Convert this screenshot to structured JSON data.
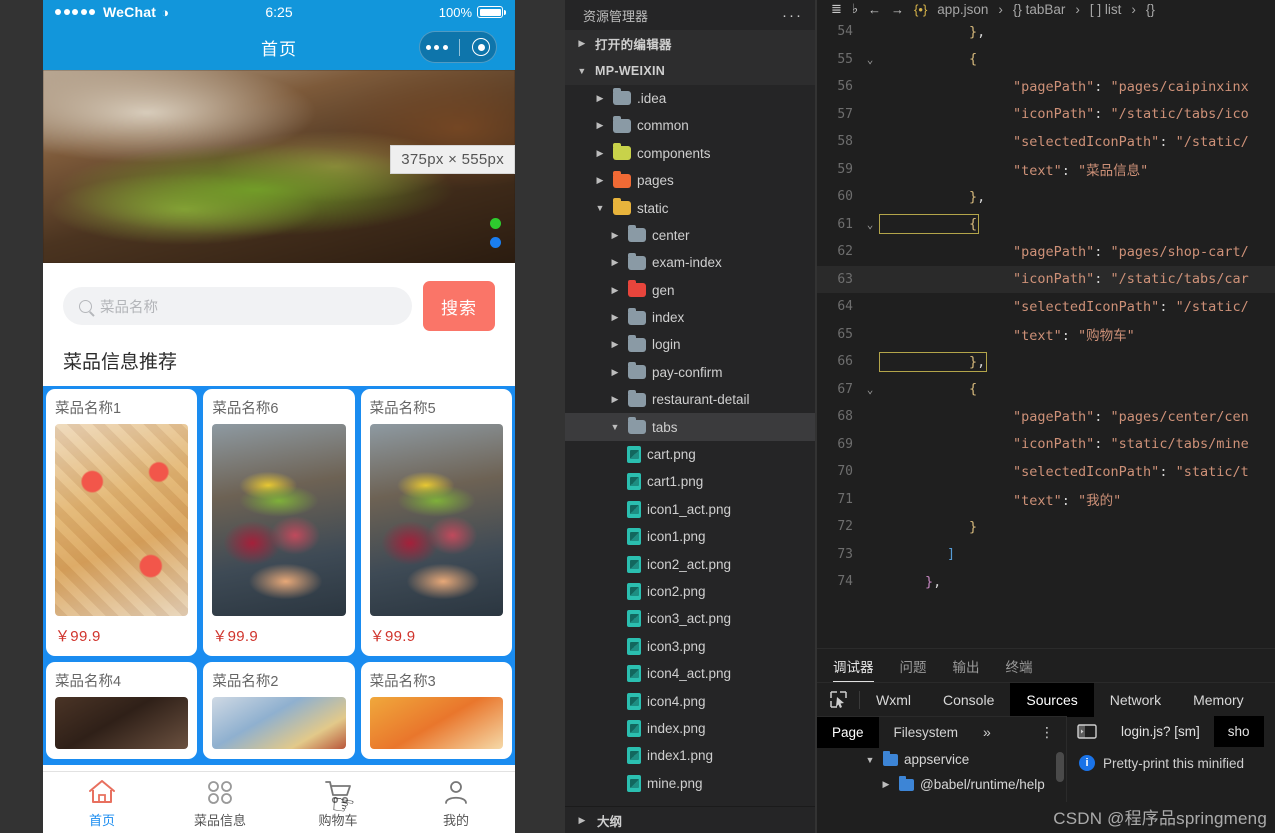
{
  "phone": {
    "status_bar": {
      "carrier": "WeChat",
      "time": "6:25",
      "battery": "100%"
    },
    "nav": {
      "title": "首页"
    },
    "hero": {
      "size_tooltip": "375px × 555px"
    },
    "search": {
      "placeholder": "菜品名称",
      "button_label": "搜索"
    },
    "section_title": "菜品信息推荐",
    "cards_row1": [
      {
        "name": "菜品名称1",
        "price": "￥99.9"
      },
      {
        "name": "菜品名称6",
        "price": "￥99.9"
      },
      {
        "name": "菜品名称5",
        "price": "￥99.9"
      }
    ],
    "cards_row2": [
      {
        "name": "菜品名称4"
      },
      {
        "name": "菜品名称2"
      },
      {
        "name": "菜品名称3"
      }
    ],
    "tabbar": [
      {
        "label": "首页",
        "icon": "home-icon",
        "active": true
      },
      {
        "label": "菜品信息",
        "icon": "grid-icon",
        "active": false
      },
      {
        "label": "购物车",
        "icon": "cart-icon",
        "active": false
      },
      {
        "label": "我的",
        "icon": "user-icon",
        "active": false
      }
    ]
  },
  "explorer": {
    "title": "资源管理器",
    "more_label": "···",
    "open_editors": "打开的编辑器",
    "project": "MP-WEIXIN",
    "folders": [
      {
        "label": ".idea",
        "color": "gray",
        "indent": 1
      },
      {
        "label": "common",
        "color": "gray",
        "indent": 1
      },
      {
        "label": "components",
        "color": "yellow",
        "indent": 1
      },
      {
        "label": "pages",
        "color": "orange",
        "indent": 1
      },
      {
        "label": "static",
        "color": "amber",
        "indent": 1,
        "expanded": true
      },
      {
        "label": "center",
        "color": "gray",
        "indent": 2
      },
      {
        "label": "exam-index",
        "color": "gray",
        "indent": 2
      },
      {
        "label": "gen",
        "color": "red",
        "indent": 2
      },
      {
        "label": "index",
        "color": "gray",
        "indent": 2
      },
      {
        "label": "login",
        "color": "gray",
        "indent": 2
      },
      {
        "label": "pay-confirm",
        "color": "gray",
        "indent": 2
      },
      {
        "label": "restaurant-detail",
        "color": "gray",
        "indent": 2
      },
      {
        "label": "tabs",
        "color": "gray",
        "indent": 2,
        "expanded": true,
        "selected": true
      }
    ],
    "files": [
      "cart.png",
      "cart1.png",
      "icon1_act.png",
      "icon1.png",
      "icon2_act.png",
      "icon2.png",
      "icon3_act.png",
      "icon3.png",
      "icon4_act.png",
      "icon4.png",
      "index.png",
      "index1.png",
      "mine.png"
    ],
    "outline": "大纲"
  },
  "editor": {
    "breadcrumb": [
      "app.json",
      "{} tabBar",
      "[ ] list",
      "{}"
    ],
    "toolbar_icons": [
      "list-icon",
      "bookmark-icon",
      "back-arrow-icon",
      "forward-arrow-icon"
    ],
    "lines": [
      {
        "n": "54",
        "fold": "",
        "indent": 4,
        "tokens": [
          {
            "t": "brace",
            "v": "}"
          },
          {
            "t": "plain",
            "v": ","
          }
        ]
      },
      {
        "n": "55",
        "fold": "v",
        "indent": 4,
        "tokens": [
          {
            "t": "brace",
            "v": "{"
          }
        ]
      },
      {
        "n": "56",
        "fold": "",
        "indent": 6,
        "tokens": [
          {
            "t": "key",
            "v": "\"pagePath\""
          },
          {
            "t": "plain",
            "v": ": "
          },
          {
            "t": "str",
            "v": "\"pages/caipinxinx"
          }
        ]
      },
      {
        "n": "57",
        "fold": "",
        "indent": 6,
        "tokens": [
          {
            "t": "key",
            "v": "\"iconPath\""
          },
          {
            "t": "plain",
            "v": ": "
          },
          {
            "t": "str",
            "v": "\"/static/tabs/ico"
          }
        ]
      },
      {
        "n": "58",
        "fold": "",
        "indent": 6,
        "tokens": [
          {
            "t": "key",
            "v": "\"selectedIconPath\""
          },
          {
            "t": "plain",
            "v": ": "
          },
          {
            "t": "str",
            "v": "\"/static/"
          }
        ]
      },
      {
        "n": "59",
        "fold": "",
        "indent": 6,
        "tokens": [
          {
            "t": "key",
            "v": "\"text\""
          },
          {
            "t": "plain",
            "v": ": "
          },
          {
            "t": "str",
            "v": "\"菜品信息\""
          }
        ]
      },
      {
        "n": "60",
        "fold": "",
        "indent": 4,
        "tokens": [
          {
            "t": "brace",
            "v": "}"
          },
          {
            "t": "plain",
            "v": ","
          }
        ]
      },
      {
        "n": "61",
        "fold": "v",
        "indent": 4,
        "tokens": [
          {
            "t": "brace",
            "v": "{"
          }
        ],
        "boxed": true
      },
      {
        "n": "62",
        "fold": "",
        "indent": 6,
        "tokens": [
          {
            "t": "key",
            "v": "\"pagePath\""
          },
          {
            "t": "plain",
            "v": ": "
          },
          {
            "t": "str",
            "v": "\"pages/shop-cart/"
          }
        ]
      },
      {
        "n": "63",
        "fold": "",
        "indent": 6,
        "tokens": [
          {
            "t": "key",
            "v": "\"iconPath\""
          },
          {
            "t": "plain",
            "v": ": "
          },
          {
            "t": "str",
            "v": "\"/static/tabs/car"
          }
        ],
        "highlight": true
      },
      {
        "n": "64",
        "fold": "",
        "indent": 6,
        "tokens": [
          {
            "t": "key",
            "v": "\"selectedIconPath\""
          },
          {
            "t": "plain",
            "v": ": "
          },
          {
            "t": "str",
            "v": "\"/static/"
          }
        ]
      },
      {
        "n": "65",
        "fold": "",
        "indent": 6,
        "tokens": [
          {
            "t": "key",
            "v": "\"text\""
          },
          {
            "t": "plain",
            "v": ": "
          },
          {
            "t": "str",
            "v": "\"购物车\""
          }
        ]
      },
      {
        "n": "66",
        "fold": "",
        "indent": 4,
        "tokens": [
          {
            "t": "brace",
            "v": "}"
          },
          {
            "t": "plain",
            "v": ","
          }
        ],
        "boxed": true
      },
      {
        "n": "67",
        "fold": "v",
        "indent": 4,
        "tokens": [
          {
            "t": "brace",
            "v": "{"
          }
        ]
      },
      {
        "n": "68",
        "fold": "",
        "indent": 6,
        "tokens": [
          {
            "t": "key",
            "v": "\"pagePath\""
          },
          {
            "t": "plain",
            "v": ": "
          },
          {
            "t": "str",
            "v": "\"pages/center/cen"
          }
        ]
      },
      {
        "n": "69",
        "fold": "",
        "indent": 6,
        "tokens": [
          {
            "t": "key",
            "v": "\"iconPath\""
          },
          {
            "t": "plain",
            "v": ": "
          },
          {
            "t": "str",
            "v": "\"static/tabs/mine"
          }
        ]
      },
      {
        "n": "70",
        "fold": "",
        "indent": 6,
        "tokens": [
          {
            "t": "key",
            "v": "\"selectedIconPath\""
          },
          {
            "t": "plain",
            "v": ": "
          },
          {
            "t": "str",
            "v": "\"static/t"
          }
        ]
      },
      {
        "n": "71",
        "fold": "",
        "indent": 6,
        "tokens": [
          {
            "t": "key",
            "v": "\"text\""
          },
          {
            "t": "plain",
            "v": ": "
          },
          {
            "t": "str",
            "v": "\"我的\""
          }
        ]
      },
      {
        "n": "72",
        "fold": "",
        "indent": 4,
        "tokens": [
          {
            "t": "brace",
            "v": "}"
          }
        ]
      },
      {
        "n": "73",
        "fold": "",
        "indent": 3,
        "tokens": [
          {
            "t": "brkt",
            "v": "]"
          }
        ]
      },
      {
        "n": "74",
        "fold": "",
        "indent": 2,
        "tokens": [
          {
            "t": "pink",
            "v": "}"
          },
          {
            "t": "plain",
            "v": ","
          }
        ]
      }
    ]
  },
  "panel": {
    "tabs": [
      {
        "label": "调试器",
        "active": true
      },
      {
        "label": "问题",
        "active": false
      },
      {
        "label": "输出",
        "active": false
      },
      {
        "label": "终端",
        "active": false
      }
    ],
    "devtools_tabs": [
      {
        "label": "Wxml",
        "active": false
      },
      {
        "label": "Console",
        "active": false
      },
      {
        "label": "Sources",
        "active": true
      },
      {
        "label": "Network",
        "active": false
      },
      {
        "label": "Memory",
        "active": false
      }
    ],
    "sources_subtabs": [
      {
        "label": "Page",
        "active": true
      },
      {
        "label": "Filesystem",
        "active": false
      }
    ],
    "sources_more": "»",
    "kebab": "⋮",
    "file_tree": [
      {
        "label": "appservice",
        "level": 1,
        "expanded": true
      },
      {
        "label": "@babel/runtime/help",
        "level": 2,
        "expanded": false
      }
    ],
    "source_tabs": [
      {
        "label": "login.js? [sm]",
        "active": false
      },
      {
        "label": "sho",
        "active": true
      }
    ],
    "info_message": "Pretty-print this minified",
    "watermark": "CSDN @程序品springmeng"
  }
}
